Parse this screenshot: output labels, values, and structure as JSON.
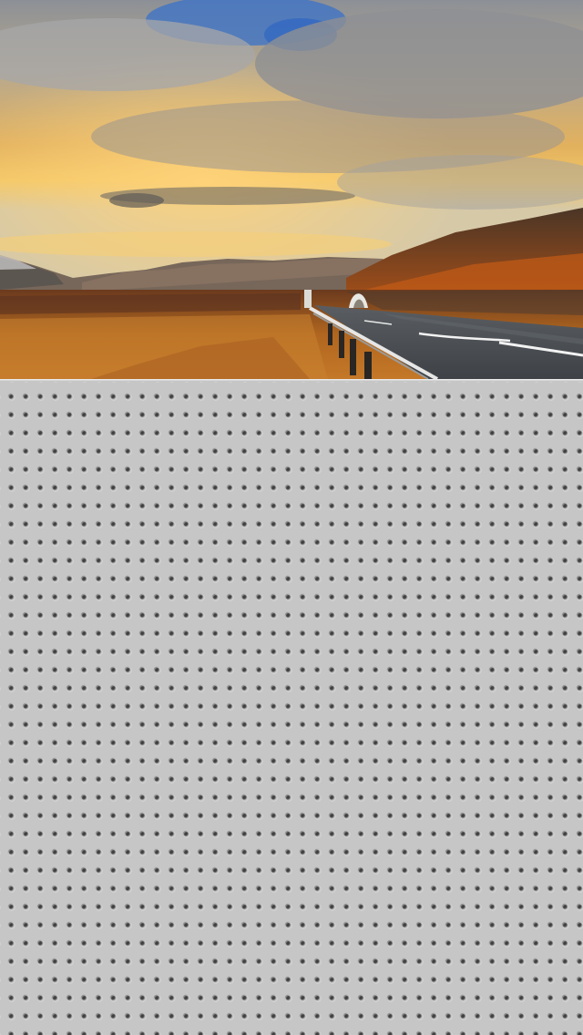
{
  "screen": {
    "header_image": {
      "subject": "landscape-road-photo"
    },
    "panel": {
      "pattern": "perforated-metal",
      "color": "#c6c6c6"
    }
  }
}
